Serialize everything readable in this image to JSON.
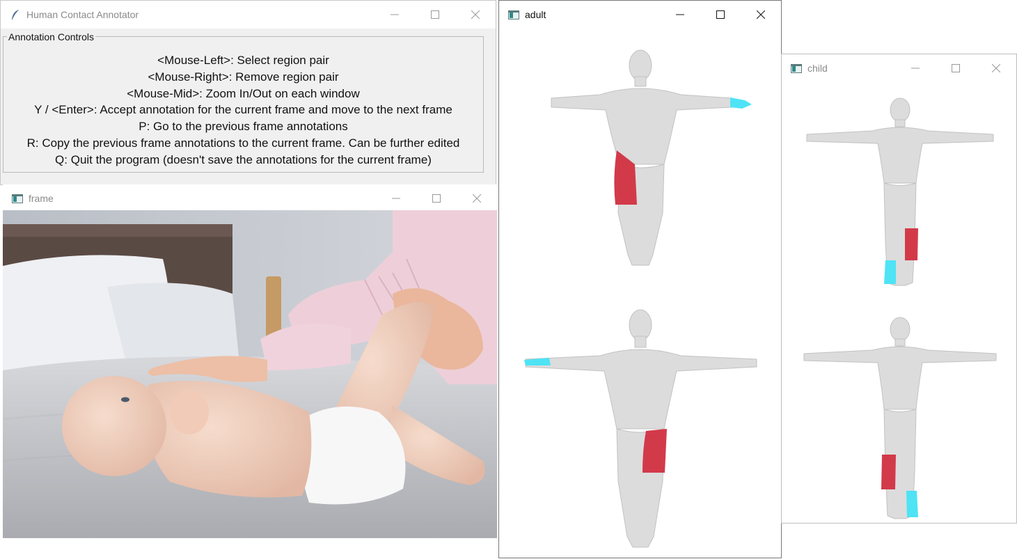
{
  "windows": {
    "annotator": {
      "title": "Human Contact Annotator",
      "group_label": "Annotation Controls",
      "help_lines": [
        "<Mouse-Left>: Select region pair",
        "<Mouse-Right>: Remove region pair",
        "<Mouse-Mid>: Zoom In/Out on each window",
        "Y / <Enter>: Accept annotation for the current frame and move to the next frame",
        "P: Go to the previous frame annotations",
        "R: Copy the previous frame annotations to the current frame. Can be further edited",
        "Q: Quit the program (doesn't save the annotations for the current frame)"
      ]
    },
    "frame": {
      "title": "frame"
    },
    "adult": {
      "title": "adult"
    },
    "child": {
      "title": "child"
    }
  },
  "colors": {
    "contact_red": "#d23a4a",
    "contact_cyan": "#4ee3f5",
    "mesh_gray": "#dcdcdc"
  },
  "icons": [
    "feather-icon",
    "app-window-icon",
    "minimize-icon",
    "maximize-icon",
    "close-icon"
  ]
}
